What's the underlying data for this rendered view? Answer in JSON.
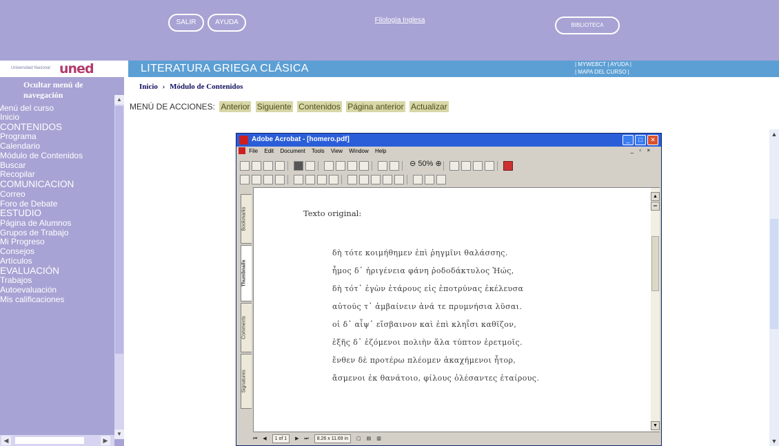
{
  "top": {
    "salir": "SALIR",
    "ayuda": "AYUDA",
    "filologia": "Filología Inglesa",
    "biblioteca": "BIBLIOTECA"
  },
  "logo": {
    "small": "Universidad Nacional",
    "main": "uned"
  },
  "course": {
    "title": "LITERATURA GRIEGA CLÁSICA",
    "links_line1": "| MYWEBCT | AYUDA |",
    "links_line2": "| MAPA DEL CURSO |"
  },
  "breadcrumb": {
    "home": "Inicio",
    "sep": "›",
    "current": "Módulo de Contenidos"
  },
  "sidebar": {
    "hide_menu": "Ocultar menú de navegación",
    "menu_title": "Menú del curso",
    "items": [
      {
        "label": "Inicio",
        "section": false
      },
      {
        "label": "CONTENIDOS",
        "section": true
      },
      {
        "label": "Programa",
        "section": false
      },
      {
        "label": "Calendario",
        "section": false
      },
      {
        "label": "Módulo de Contenidos",
        "section": false
      },
      {
        "label": "Buscar",
        "section": false
      },
      {
        "label": "Recopilar",
        "section": false
      },
      {
        "label": "COMUNICACION",
        "section": true
      },
      {
        "label": "Correo",
        "section": false
      },
      {
        "label": "Foro de Debate",
        "section": false
      },
      {
        "label": "ESTUDIO",
        "section": true
      },
      {
        "label": "Página de Alumnos",
        "section": false
      },
      {
        "label": "Grupos de Trabajo",
        "section": false
      },
      {
        "label": "Mi Progreso",
        "section": false
      },
      {
        "label": "Consejos",
        "section": false
      },
      {
        "label": "Artículos",
        "section": false
      },
      {
        "label": "EVALUACIÓN",
        "section": true
      },
      {
        "label": "Trabajos",
        "section": false
      },
      {
        "label": "Autoevaluación",
        "section": false
      },
      {
        "label": "Mis calificaciones",
        "section": false
      }
    ]
  },
  "actions": {
    "label": "MENÚ DE ACCIONES:",
    "buttons": [
      "Anterior",
      "Siguiente",
      "Contenidos",
      "Página anterior",
      "Actualizar"
    ]
  },
  "acrobat": {
    "title": "Adobe Acrobat - [homero.pdf]",
    "menu": [
      "File",
      "Edit",
      "Document",
      "Tools",
      "View",
      "Window",
      "Help"
    ],
    "zoom": "50%",
    "tabs": [
      "Bookmarks",
      "Thumbnails",
      "Comments",
      "Signatures"
    ],
    "heading": "Texto original:",
    "lines": [
      "δὴ τότε κοιμήθημεν ἐπὶ ῥηγμῖνι θαλάσσης.",
      "ἦμος δ᾽ ἠριγένεια φάνη ῥοδοδάκτυλος Ἠώς,",
      "δὴ τότ᾽ ἐγὼν ἑτάρους εἰς ἐποτρύνας ἐκέλευσα",
      "αὐτούς τ᾽ ἀμβαίνειν ἀνά τε πρυμνήσια λῦσαι.",
      "οἱ δ᾽ αἶψ᾽ εἴσβαινον καὶ ἐπὶ κληῗσι καθῖζον,",
      "ἑξῆς δ᾽ ἑζόμενοι πολιὴν ἅλα τύπτον ἐρετμοῖς.",
      "ἔνθεν δὲ προτέρω πλέομεν ἀκαχήμενοι ἦτορ,",
      "ἄσμενοι ἐκ θανάτοιο, φίλους ὀλέσαντες ἑταίρους."
    ],
    "status": {
      "page": "1 of 1",
      "size": "8.26 x 11.69 in"
    }
  }
}
